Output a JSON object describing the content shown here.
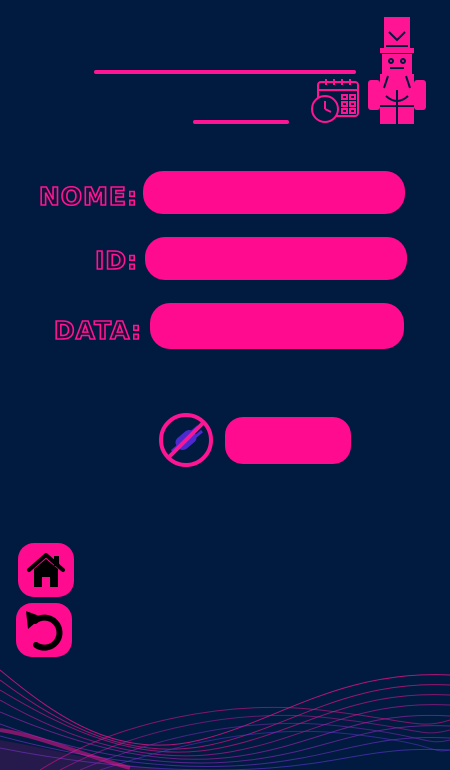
{
  "form": {
    "nome_label": "NOME:",
    "id_label": "ID:",
    "data_label": "DATA:",
    "nome_value": "",
    "id_value": "",
    "data_value": ""
  },
  "actions": {
    "disconnect_icon": "no-plug-icon",
    "submit_label": ""
  },
  "nav": {
    "home_icon": "home-icon",
    "back_icon": "undo-arrow-icon"
  },
  "header": {
    "calendar_icon": "calendar-clock-icon",
    "mascot": "nutcracker-icon"
  },
  "colors": {
    "background": "#011a40",
    "accent": "#ff0b8f",
    "purple": "#4b2bd0"
  }
}
